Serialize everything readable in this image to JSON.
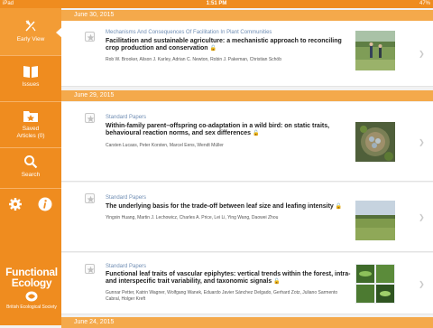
{
  "status": {
    "device": "iPad",
    "time": "1:51 PM",
    "battery": "47%"
  },
  "sidebar": {
    "items": [
      {
        "label": "Early View",
        "icon": "leaf-icon",
        "active": true
      },
      {
        "label": "Issues",
        "icon": "book-icon"
      },
      {
        "label": "Saved Articles (0)",
        "icon": "saved-folder-icon"
      },
      {
        "label": "Search",
        "icon": "search-icon"
      }
    ],
    "bottom_icons": [
      "gear-icon",
      "info-icon"
    ],
    "brand_title": "Functional Ecology",
    "brand_society": "British Ecological Society"
  },
  "groups": [
    {
      "date": "June 30, 2015",
      "articles": [
        {
          "section": "Mechanisms And Consequences Of Facilitation In Plant Communities",
          "title": "Facilitation and sustainable agriculture: a mechanistic approach to reconciling crop production and conservation",
          "open_access": true,
          "authors": "Rob W. Brooker, Alison J. Karley, Adrian C. Newton, Robin J. Pakeman, Christian Schöb",
          "thumb": "field-photo"
        }
      ]
    },
    {
      "date": "June 29, 2015",
      "articles": [
        {
          "section": "Standard Papers",
          "title": "Within-family parent–offspring co-adaptation in a wild bird: on static traits, behavioural reaction norms, and sex differences",
          "open_access": true,
          "authors": "Carsten Lucass, Peter Korsten, Marcel Eens, Wendt Müller",
          "thumb": "nest-photo"
        },
        {
          "section": "Standard Papers",
          "title": "The underlying basis for the trade-off between leaf size and leafing intensity",
          "open_access": true,
          "authors": "Yingxin Huang, Martin J. Lechowicz, Charles A. Price, Lei Li, Ying Wang, Daowei Zhou",
          "thumb": "grassland-photo"
        },
        {
          "section": "Standard Papers",
          "title": "Functional leaf traits of vascular epiphytes: vertical trends within the forest, intra- and interspecific trait variability, and taxonomic signals",
          "open_access": true,
          "authors": "Gunnar Petter, Katrin Wagner, Wolfgang Wanek, Eduardo Javier Sánchez Delgado, Gerhard Zotz, Juliano Sarmento Cabral, Holger Kreft",
          "thumb": "epiphyte-photo"
        }
      ]
    },
    {
      "date": "June 24, 2015",
      "articles": []
    }
  ],
  "colors": {
    "brand": "#ef8c1f",
    "date_bar": "#f4a94b",
    "section": "#6f8db3"
  }
}
